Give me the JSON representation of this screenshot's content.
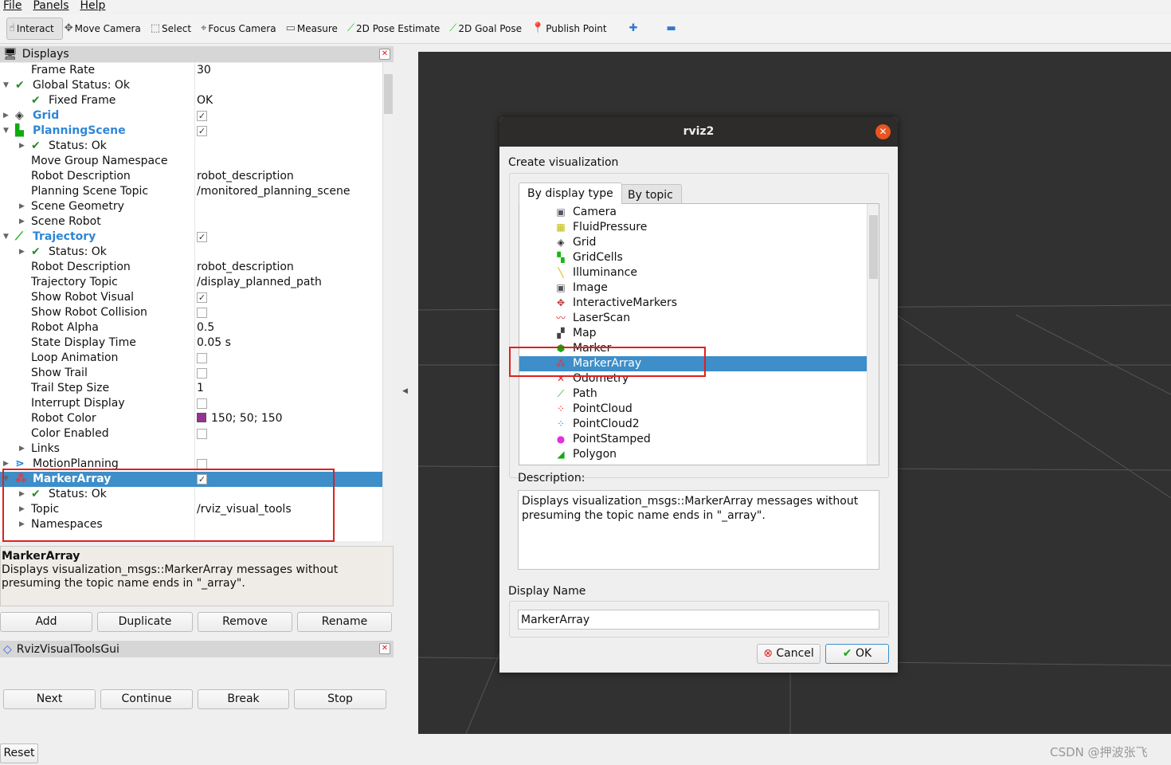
{
  "menu": [
    "File",
    "Panels",
    "Help"
  ],
  "toolbar": [
    {
      "label": "Interact",
      "icon": "hand-icon",
      "active": true
    },
    {
      "label": "Move Camera",
      "icon": "move-camera-icon"
    },
    {
      "label": "Select",
      "icon": "select-icon"
    },
    {
      "label": "Focus Camera",
      "icon": "focus-camera-icon"
    },
    {
      "label": "Measure",
      "icon": "ruler-icon"
    },
    {
      "label": "2D Pose Estimate",
      "icon": "green-arrow-icon"
    },
    {
      "label": "2D Goal Pose",
      "icon": "green-arrow-icon"
    },
    {
      "label": "Publish Point",
      "icon": "map-pin-icon"
    },
    {
      "label": "",
      "icon": "plus-icon"
    },
    {
      "label": "",
      "icon": "minus-icon"
    }
  ],
  "displays": {
    "title": "Displays",
    "rows": [
      {
        "label": "Frame Rate",
        "indent": 1,
        "value": "30"
      },
      {
        "label": "Global Status: Ok",
        "indent": 0,
        "arrow": "open",
        "check": true
      },
      {
        "label": "Fixed Frame",
        "indent": 1,
        "check": true,
        "value": "OK"
      },
      {
        "label": "Grid",
        "indent": 0,
        "arrow": "closed",
        "icon": "grid-icon",
        "blue": true,
        "checkbox": true
      },
      {
        "label": "PlanningScene",
        "indent": 0,
        "arrow": "open",
        "icon": "planning-scene-icon",
        "blue": true,
        "checkbox": true
      },
      {
        "label": "Status: Ok",
        "indent": 1,
        "arrow": "closed",
        "check": true
      },
      {
        "label": "Move Group Namespace",
        "indent": 1
      },
      {
        "label": "Robot Description",
        "indent": 1,
        "value": "robot_description"
      },
      {
        "label": "Planning Scene Topic",
        "indent": 1,
        "value": "/monitored_planning_scene"
      },
      {
        "label": "Scene Geometry",
        "indent": 1,
        "arrow": "closed"
      },
      {
        "label": "Scene Robot",
        "indent": 1,
        "arrow": "closed"
      },
      {
        "label": "Trajectory",
        "indent": 0,
        "arrow": "open",
        "icon": "trajectory-icon",
        "blue": true,
        "checkbox": true
      },
      {
        "label": "Status: Ok",
        "indent": 1,
        "arrow": "closed",
        "check": true
      },
      {
        "label": "Robot Description",
        "indent": 1,
        "value": "robot_description"
      },
      {
        "label": "Trajectory Topic",
        "indent": 1,
        "value": "/display_planned_path"
      },
      {
        "label": "Show Robot Visual",
        "indent": 1,
        "checkbox": true
      },
      {
        "label": "Show Robot Collision",
        "indent": 1,
        "checkbox": false
      },
      {
        "label": "Robot Alpha",
        "indent": 1,
        "value": "0.5"
      },
      {
        "label": "State Display Time",
        "indent": 1,
        "value": "0.05 s"
      },
      {
        "label": "Loop Animation",
        "indent": 1,
        "checkbox": false
      },
      {
        "label": "Show Trail",
        "indent": 1,
        "checkbox": false
      },
      {
        "label": "Trail Step Size",
        "indent": 1,
        "value": "1"
      },
      {
        "label": "Interrupt Display",
        "indent": 1,
        "checkbox": false
      },
      {
        "label": "Robot Color",
        "indent": 1,
        "value": "150; 50; 150",
        "color": "#963296"
      },
      {
        "label": "Color Enabled",
        "indent": 1,
        "checkbox": false
      },
      {
        "label": "Links",
        "indent": 1,
        "arrow": "closed"
      },
      {
        "label": "MotionPlanning",
        "indent": 0,
        "arrow": "closed",
        "icon": "motion-planning-icon",
        "checkbox": false
      },
      {
        "label": "MarkerArray",
        "indent": 0,
        "arrow": "open",
        "icon": "marker-array-icon",
        "blue": true,
        "checkbox": true,
        "selected": true
      },
      {
        "label": "Status: Ok",
        "indent": 1,
        "arrow": "closed",
        "check": true
      },
      {
        "label": "Topic",
        "indent": 1,
        "arrow": "closed",
        "value": "/rviz_visual_tools"
      },
      {
        "label": "Namespaces",
        "indent": 1,
        "arrow": "closed"
      }
    ],
    "desc_title": "MarkerArray",
    "desc_text": "Displays visualization_msgs::MarkerArray messages without presuming the topic name ends in \"_array\".",
    "buttons": [
      "Add",
      "Duplicate",
      "Remove",
      "Rename"
    ]
  },
  "tools_panel": {
    "title": "RvizVisualToolsGui",
    "buttons": [
      "Next",
      "Continue",
      "Break",
      "Stop"
    ]
  },
  "reset": "Reset",
  "dialog": {
    "title": "rviz2",
    "section": "Create visualization",
    "tabs": [
      "By display type",
      "By topic"
    ],
    "items": [
      {
        "label": "Camera",
        "icon": "camera-icon",
        "glyph": "▣",
        "color": "#556"
      },
      {
        "label": "FluidPressure",
        "icon": "fluid-pressure-icon",
        "glyph": "▦",
        "color": "#bb0"
      },
      {
        "label": "Grid",
        "icon": "grid-icon",
        "glyph": "◈",
        "color": "#333"
      },
      {
        "label": "GridCells",
        "icon": "grid-cells-icon",
        "glyph": "▚",
        "color": "#1b1"
      },
      {
        "label": "Illuminance",
        "icon": "illuminance-icon",
        "glyph": "╲",
        "color": "#cb0"
      },
      {
        "label": "Image",
        "icon": "image-icon",
        "glyph": "▣",
        "color": "#555"
      },
      {
        "label": "InteractiveMarkers",
        "icon": "interactive-markers-icon",
        "glyph": "✥",
        "color": "#b33"
      },
      {
        "label": "LaserScan",
        "icon": "laser-scan-icon",
        "glyph": "〰",
        "color": "#d22"
      },
      {
        "label": "Map",
        "icon": "map-icon",
        "glyph": "▞",
        "color": "#444"
      },
      {
        "label": "Marker",
        "icon": "marker-icon",
        "glyph": "⬢",
        "color": "#1a1"
      },
      {
        "label": "MarkerArray",
        "icon": "marker-array-icon",
        "glyph": "⁂",
        "color": "#e33",
        "selected": true
      },
      {
        "label": "Odometry",
        "icon": "odometry-icon",
        "glyph": "✕",
        "color": "#d22"
      },
      {
        "label": "Path",
        "icon": "path-icon",
        "glyph": "⟋",
        "color": "#1a1"
      },
      {
        "label": "PointCloud",
        "icon": "point-cloud-icon",
        "glyph": "⁘",
        "color": "#d22"
      },
      {
        "label": "PointCloud2",
        "icon": "point-cloud2-icon",
        "glyph": "⁘",
        "color": "#28d"
      },
      {
        "label": "PointStamped",
        "icon": "point-stamped-icon",
        "glyph": "●",
        "color": "#d3d"
      },
      {
        "label": "Polygon",
        "icon": "polygon-icon",
        "glyph": "◢",
        "color": "#1a1"
      }
    ],
    "desc_label": "Description:",
    "description": "Displays visualization_msgs::MarkerArray messages without presuming the topic name ends in \"_array\".",
    "name_label": "Display Name",
    "name_value": "MarkerArray",
    "cancel": "Cancel",
    "ok": "OK"
  },
  "watermark": "CSDN @押波张飞"
}
